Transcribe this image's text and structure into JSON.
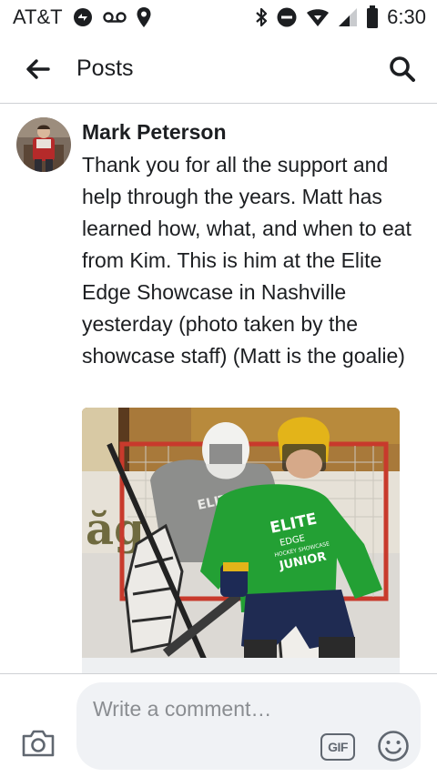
{
  "status_bar": {
    "carrier": "AT&T",
    "time": "6:30"
  },
  "app_bar": {
    "title": "Posts"
  },
  "post": {
    "author": "Mark Peterson",
    "text": "Thank you for all the support and help through the years. Matt has learned how, what, and when to eat from Kim.  This is him at the Elite Edge Showcase in Nashville yesterday (photo taken by the showcase staff) (Matt is the goalie)",
    "photo_jersey_text": [
      "ELITE",
      "EDGE",
      "HOCKEY SHOWCASE",
      "JUNIOR"
    ]
  },
  "composer": {
    "placeholder": "Write a comment…",
    "gif_label": "GIF"
  },
  "colors": {
    "text": "#1c1e21",
    "muted": "#8a8d91",
    "input_bg": "#f0f2f5",
    "divider": "#cfd1d4"
  }
}
